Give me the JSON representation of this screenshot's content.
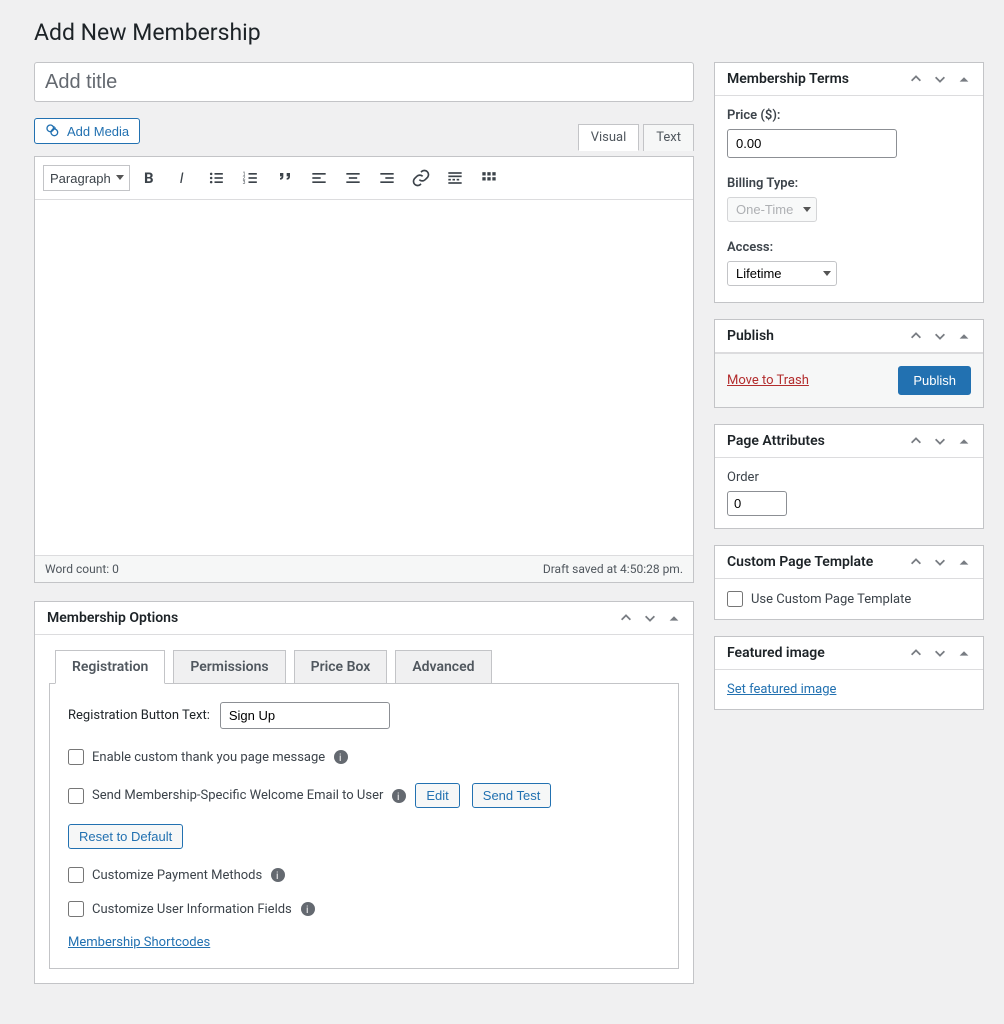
{
  "page_title": "Add New Membership",
  "title_placeholder": "Add title",
  "add_media": "Add Media",
  "editor": {
    "tab_visual": "Visual",
    "tab_text": "Text",
    "format_select": "Paragraph",
    "word_count_label": "Word count: 0",
    "draft_saved": "Draft saved at 4:50:28 pm."
  },
  "membership_options": {
    "title": "Membership Options",
    "tabs": {
      "registration": "Registration",
      "permissions": "Permissions",
      "price_box": "Price Box",
      "advanced": "Advanced"
    },
    "reg_btn_label": "Registration Button Text:",
    "reg_btn_value": "Sign Up",
    "enable_thankyou": "Enable custom thank you page message",
    "send_welcome": "Send Membership-Specific Welcome Email to User",
    "edit": "Edit",
    "send_test": "Send Test",
    "reset": "Reset to Default",
    "customize_payment": "Customize Payment Methods",
    "customize_userinfo": "Customize User Information Fields",
    "shortcodes": "Membership Shortcodes"
  },
  "terms": {
    "title": "Membership Terms",
    "price_label": "Price ($):",
    "price_value": "0.00",
    "billing_label": "Billing Type:",
    "billing_value": "One-Time",
    "access_label": "Access:",
    "access_value": "Lifetime"
  },
  "publish": {
    "title": "Publish",
    "trash": "Move to Trash",
    "publish_btn": "Publish"
  },
  "page_attr": {
    "title": "Page Attributes",
    "order_label": "Order",
    "order_value": "0"
  },
  "custom_tpl": {
    "title": "Custom Page Template",
    "label": "Use Custom Page Template"
  },
  "featured": {
    "title": "Featured image",
    "link": "Set featured image"
  }
}
